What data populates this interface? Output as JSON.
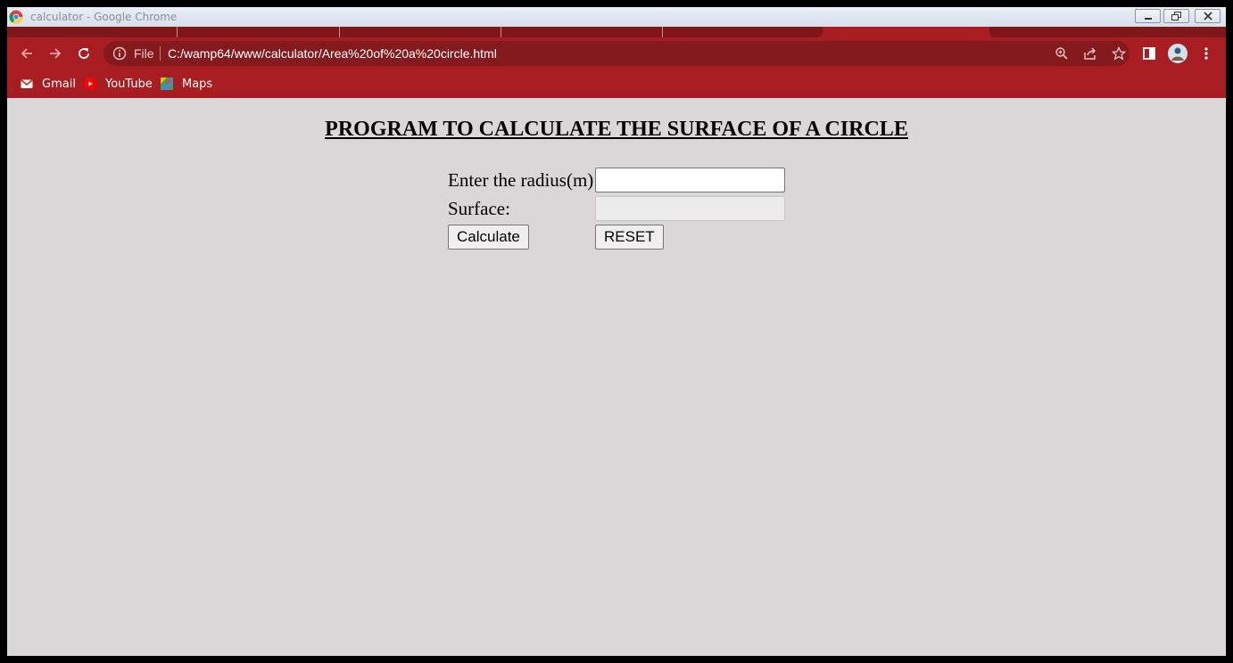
{
  "window": {
    "title": "calculator - Google Chrome"
  },
  "toolbar": {
    "scheme_label": "File",
    "url": "C:/wamp64/www/calculator/Area%20of%20a%20circle.html"
  },
  "bookmarks": [
    {
      "label": "Gmail",
      "icon": "gmail-icon"
    },
    {
      "label": "YouTube",
      "icon": "youtube-icon"
    },
    {
      "label": "Maps",
      "icon": "maps-icon"
    }
  ],
  "page": {
    "title": "PROGRAM TO CALCULATE THE SURFACE OF A CIRCLE",
    "radius_label": "Enter the radius(m):",
    "radius_value": "",
    "surface_label": "Surface:",
    "surface_value": "",
    "calculate_label": "Calculate",
    "reset_label": "RESET"
  },
  "colors": {
    "chrome_frame": "#a81d22",
    "omnibox": "#851a1e",
    "page_background": "#d9d7d8"
  }
}
